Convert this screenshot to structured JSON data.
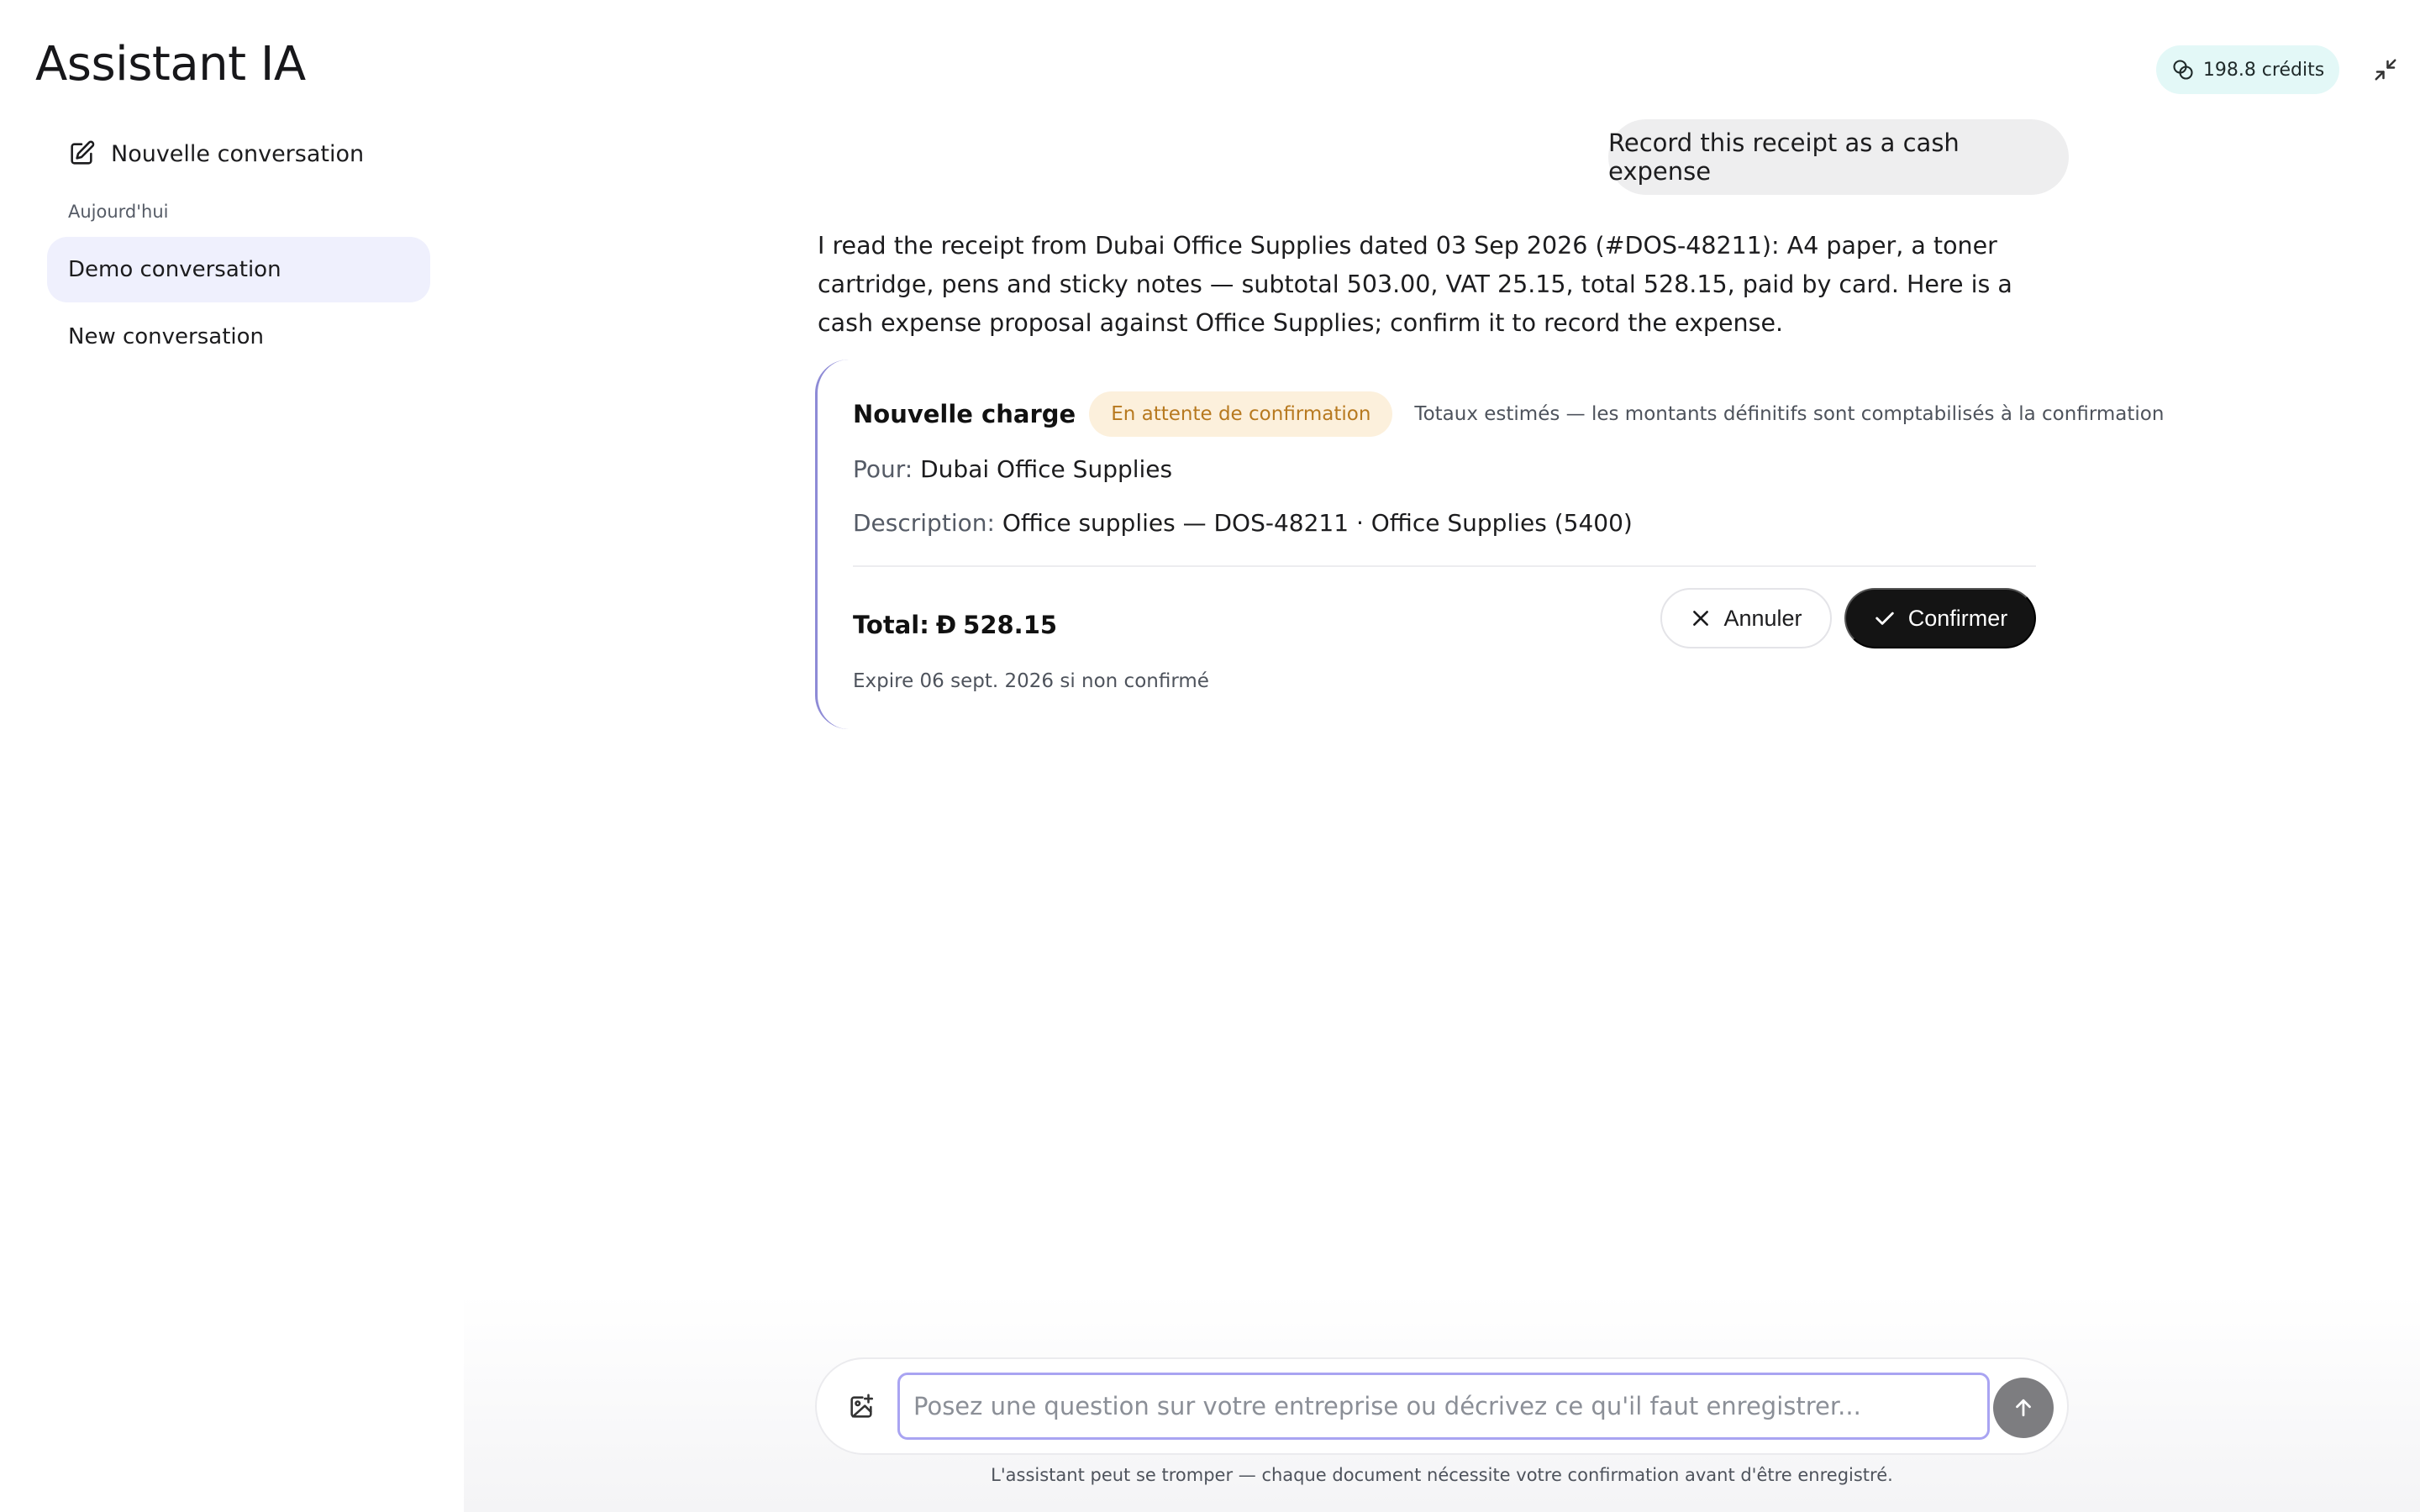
{
  "header": {
    "title": "Assistant IA",
    "credits": "198.8 crédits",
    "credits_icon": "coins-icon",
    "collapse_icon": "collapse-icon"
  },
  "sidebar": {
    "new_conversation": "Nouvelle conversation",
    "new_conversation_icon": "edit-icon",
    "section_label": "Aujourd'hui",
    "items": [
      {
        "label": "Demo conversation",
        "active": true
      },
      {
        "label": "New conversation",
        "active": false
      }
    ]
  },
  "chat": {
    "user_message": "Record this receipt as a cash expense",
    "assistant_message": "I read the receipt from Dubai Office Supplies dated 03 Sep 2026 (#DOS-48211): A4 paper, a toner cartridge, pens and sticky notes — subtotal 503.00, VAT 25.15, total 528.15, paid by card. Here is a cash expense proposal against Office Supplies; confirm it to record the expense.",
    "card": {
      "title": "Nouvelle charge",
      "status": "En attente de confirmation",
      "note": "Totaux estimés — les montants définitifs sont comptabilisés à la confirmation",
      "pour_label": "Pour:",
      "pour_value": "Dubai Office Supplies",
      "description_label": "Description:",
      "description_value": "Office supplies — DOS-48211 · Office Supplies (5400)",
      "total_label": "Total:",
      "currency_symbol": "Đ",
      "total_value": "528.15",
      "cancel_label": "Annuler",
      "confirm_label": "Confirmer",
      "expiry": "Expire 06 sept. 2026 si non confirmé",
      "accent_color": "#8e8bd6",
      "status_color": "#b7791f"
    }
  },
  "composer": {
    "placeholder": "Posez une question sur votre entreprise ou décrivez ce qu'il faut enregistrer...",
    "attach_icon": "image-plus-icon",
    "send_icon": "arrow-up-icon",
    "disclaimer": "L'assistant peut se tromper — chaque document nécessite votre confirmation avant d'être enregistré."
  }
}
